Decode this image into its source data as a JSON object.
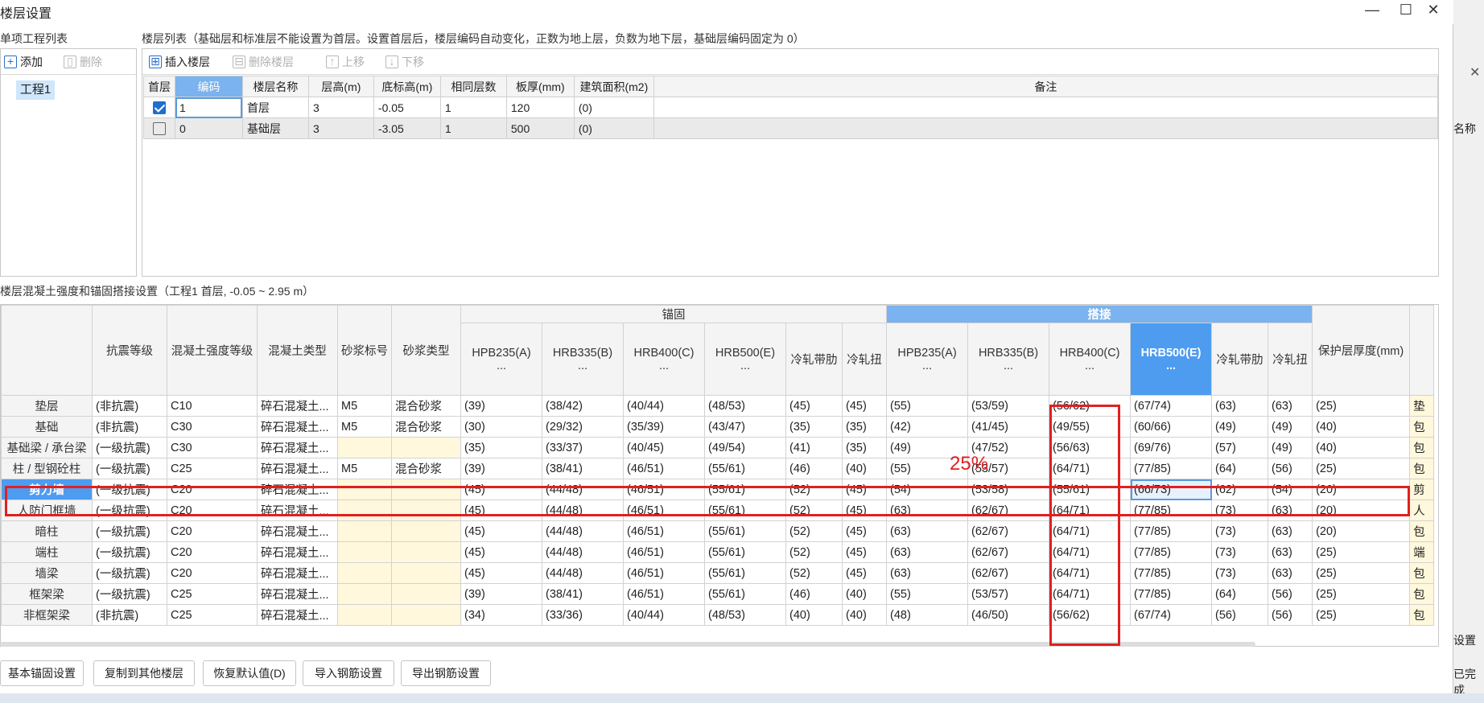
{
  "window": {
    "title": "楼层设置",
    "minimize_icon": "minimize-icon",
    "maximize_icon": "maximize-icon",
    "close_icon": "close-icon"
  },
  "project_list": {
    "label": "单项工程列表",
    "add_label": "添加",
    "delete_label": "删除",
    "items": [
      "工程1"
    ]
  },
  "floor_list": {
    "label": "楼层列表（基础层和标准层不能设置为首层。设置首层后，楼层编码自动变化，正数为地上层，负数为地下层，基础层编码固定为 0）",
    "insert_label": "插入楼层",
    "delete_label": "删除楼层",
    "up_label": "上移",
    "down_label": "下移",
    "columns": [
      "首层",
      "编码",
      "楼层名称",
      "层高(m)",
      "底标高(m)",
      "相同层数",
      "板厚(mm)",
      "建筑面积(m2)",
      "备注"
    ],
    "rows": [
      {
        "first": true,
        "code": "1",
        "name": "首层",
        "height": "3",
        "bottom": "-0.05",
        "same": "1",
        "slab": "120",
        "area": "(0)",
        "note": ""
      },
      {
        "first": false,
        "code": "0",
        "name": "基础层",
        "height": "3",
        "bottom": "-3.05",
        "same": "1",
        "slab": "500",
        "area": "(0)",
        "note": ""
      }
    ]
  },
  "settings": {
    "label": "楼层混凝土强度和锚固搭接设置（工程1  首层, -0.05 ~ 2.95 m）",
    "group_anchor": "锚固",
    "group_lap": "搭接",
    "columns": [
      "抗震等级",
      "混凝土强度等级",
      "混凝土类型",
      "砂浆标号",
      "砂浆类型",
      "HPB235(A)\n...",
      "HRB335(B)\n...",
      "HRB400(C)\n...",
      "HRB500(E)\n...",
      "冷轧带肋",
      "冷轧扭",
      "HPB235(A)\n...",
      "HRB335(B)\n...",
      "HRB400(C)\n...",
      "HRB500(E)\n...",
      "冷轧带肋",
      "冷轧扭",
      "保护层厚度(mm)"
    ],
    "rows": [
      {
        "name": "垫层",
        "cells": [
          "(非抗震)",
          "C10",
          "碎石混凝土...",
          "M5",
          "混合砂浆",
          "(39)",
          "(38/42)",
          "(40/44)",
          "(48/53)",
          "(45)",
          "(45)",
          "(55)",
          "(53/59)",
          "(56/62)",
          "(67/74)",
          "(63)",
          "(63)",
          "(25)",
          "垫"
        ]
      },
      {
        "name": "基础",
        "cells": [
          "(非抗震)",
          "C30",
          "碎石混凝土...",
          "M5",
          "混合砂浆",
          "(30)",
          "(29/32)",
          "(35/39)",
          "(43/47)",
          "(35)",
          "(35)",
          "(42)",
          "(41/45)",
          "(49/55)",
          "(60/66)",
          "(49)",
          "(49)",
          "(40)",
          "包"
        ]
      },
      {
        "name": "基础梁 / 承台梁",
        "cells": [
          "(一级抗震)",
          "C30",
          "碎石混凝土...",
          "",
          "",
          "(35)",
          "(33/37)",
          "(40/45)",
          "(49/54)",
          "(41)",
          "(35)",
          "(49)",
          "(47/52)",
          "(56/63)",
          "(69/76)",
          "(57)",
          "(49)",
          "(40)",
          "包"
        ]
      },
      {
        "name": "柱 / 型钢砼柱",
        "cells": [
          "(一级抗震)",
          "C25",
          "碎石混凝土...",
          "M5",
          "混合砂浆",
          "(39)",
          "(38/41)",
          "(46/51)",
          "(55/61)",
          "(46)",
          "(40)",
          "(55)",
          "(53/57)",
          "(64/71)",
          "(77/85)",
          "(64)",
          "(56)",
          "(25)",
          "包"
        ]
      },
      {
        "name": "剪力墙",
        "active": true,
        "cells": [
          "(一级抗震)",
          "C20",
          "碎石混凝土...",
          "",
          "",
          "(45)",
          "(44/48)",
          "(46/51)",
          "(55/61)",
          "(52)",
          "(45)",
          "(54)",
          "(53/58)",
          "(55/61)",
          "(66/73)",
          "(62)",
          "(54)",
          "(20)",
          "剪"
        ]
      },
      {
        "name": "人防门框墙",
        "cells": [
          "(一级抗震)",
          "C20",
          "碎石混凝土...",
          "",
          "",
          "(45)",
          "(44/48)",
          "(46/51)",
          "(55/61)",
          "(52)",
          "(45)",
          "(63)",
          "(62/67)",
          "(64/71)",
          "(77/85)",
          "(73)",
          "(63)",
          "(20)",
          "人"
        ]
      },
      {
        "name": "暗柱",
        "cells": [
          "(一级抗震)",
          "C20",
          "碎石混凝土...",
          "",
          "",
          "(45)",
          "(44/48)",
          "(46/51)",
          "(55/61)",
          "(52)",
          "(45)",
          "(63)",
          "(62/67)",
          "(64/71)",
          "(77/85)",
          "(73)",
          "(63)",
          "(20)",
          "包"
        ]
      },
      {
        "name": "端柱",
        "cells": [
          "(一级抗震)",
          "C20",
          "碎石混凝土...",
          "",
          "",
          "(45)",
          "(44/48)",
          "(46/51)",
          "(55/61)",
          "(52)",
          "(45)",
          "(63)",
          "(62/67)",
          "(64/71)",
          "(77/85)",
          "(73)",
          "(63)",
          "(25)",
          "端"
        ]
      },
      {
        "name": "墙梁",
        "cells": [
          "(一级抗震)",
          "C20",
          "碎石混凝土...",
          "",
          "",
          "(45)",
          "(44/48)",
          "(46/51)",
          "(55/61)",
          "(52)",
          "(45)",
          "(63)",
          "(62/67)",
          "(64/71)",
          "(77/85)",
          "(73)",
          "(63)",
          "(25)",
          "包"
        ]
      },
      {
        "name": "框架梁",
        "cells": [
          "(一级抗震)",
          "C25",
          "碎石混凝土...",
          "",
          "",
          "(39)",
          "(38/41)",
          "(46/51)",
          "(55/61)",
          "(46)",
          "(40)",
          "(55)",
          "(53/57)",
          "(64/71)",
          "(77/85)",
          "(64)",
          "(56)",
          "(25)",
          "包"
        ]
      },
      {
        "name": "非框架梁",
        "cells": [
          "(非抗震)",
          "C25",
          "碎石混凝土...",
          "",
          "",
          "(34)",
          "(33/36)",
          "(40/44)",
          "(48/53)",
          "(40)",
          "(40)",
          "(48)",
          "(46/50)",
          "(56/62)",
          "(67/74)",
          "(56)",
          "(56)",
          "(25)",
          "包"
        ]
      }
    ]
  },
  "annotation": {
    "percent": "25%"
  },
  "buttons": {
    "basic_anchor": "基本锚固设置",
    "copy_to_floors": "复制到其他楼层",
    "restore_default": "恢复默认值(D)",
    "import_rebar": "导入钢筋设置",
    "export_rebar": "导出钢筋设置"
  },
  "background_window": {
    "name_fragment": "名称",
    "set_fragment": "设置",
    "done_fragment": "已完成"
  }
}
